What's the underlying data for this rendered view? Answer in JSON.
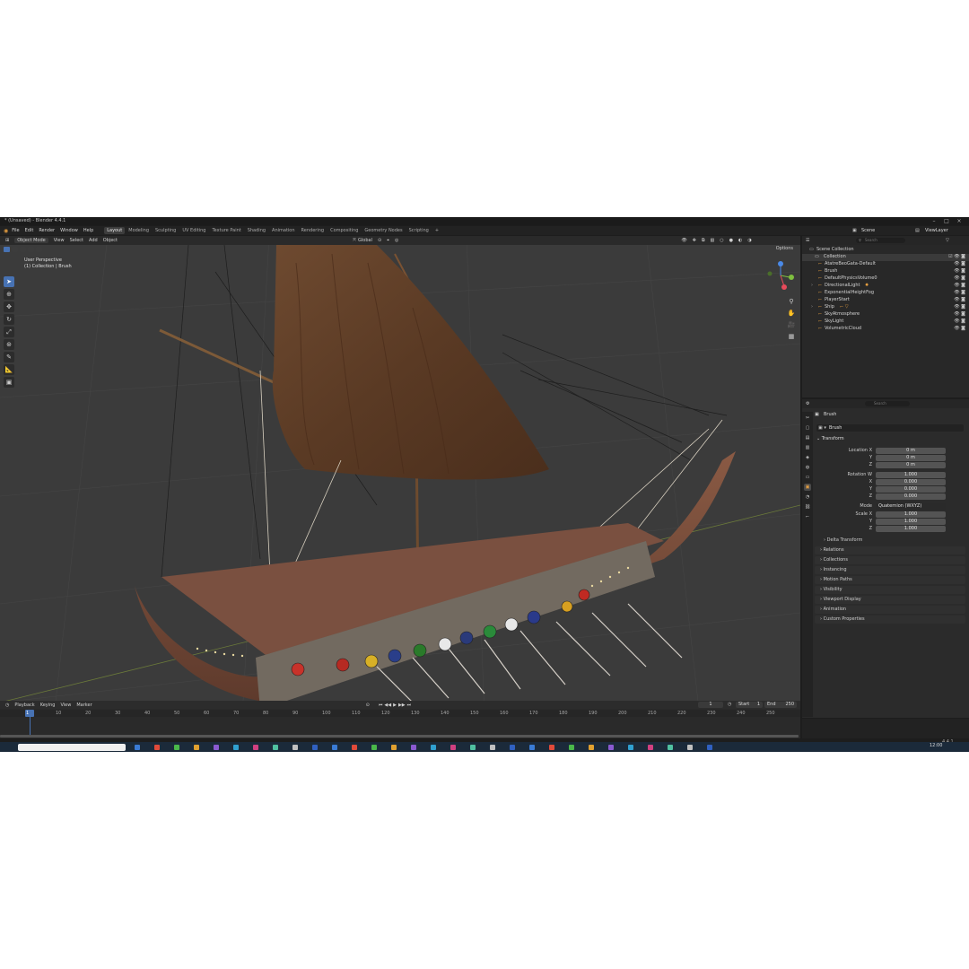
{
  "window": {
    "title": "* (Unsaved) - Blender 4.4.1"
  },
  "menu": [
    "File",
    "Edit",
    "Render",
    "Window",
    "Help"
  ],
  "workspaces": [
    "Layout",
    "Modeling",
    "Sculpting",
    "UV Editing",
    "Texture Paint",
    "Shading",
    "Animation",
    "Rendering",
    "Compositing",
    "Geometry Nodes",
    "Scripting"
  ],
  "top_right": {
    "scene": "Scene",
    "view_layer": "ViewLayer"
  },
  "viewport": {
    "mode": "Object Mode",
    "menu": [
      "View",
      "Select",
      "Add",
      "Object"
    ],
    "orientation": "Global",
    "options_label": "Options",
    "overlay_title": "User Perspective",
    "overlay_sub": "(1) Collection | Brush"
  },
  "outliner": {
    "search_placeholder": "Search",
    "root": "Scene Collection",
    "collection": "Collection",
    "items": [
      "AtatreBeoGata-Default",
      "Brush",
      "DefaultPhysicsVolume0",
      "DirectionalLight",
      "ExponentialHeightFog",
      "PlayerStart",
      "Ship",
      "SkyAtmosphere",
      "SkyLight",
      "VolumetricCloud"
    ]
  },
  "properties": {
    "search_placeholder": "Search",
    "object_name": "Brush",
    "data_name": "Brush",
    "transform_label": "Transform",
    "location": {
      "label": "Location X",
      "y_label": "Y",
      "z_label": "Z",
      "x": "0 m",
      "y": "0 m",
      "z": "0 m"
    },
    "rotation": {
      "label": "Rotation W",
      "x_label": "X",
      "y_label": "Y",
      "z_label": "Z",
      "w": "1.000",
      "x": "0.000",
      "y": "0.000",
      "z": "0.000"
    },
    "mode_label": "Mode",
    "mode_value": "Quaternion (WXYZ)",
    "scale": {
      "label": "Scale X",
      "y_label": "Y",
      "z_label": "Z",
      "x": "1.000",
      "y": "1.000",
      "z": "1.000"
    },
    "delta_transform": "Delta Transform",
    "panels": [
      "Relations",
      "Collections",
      "Instancing",
      "Motion Paths",
      "Visibility",
      "Viewport Display",
      "Animation",
      "Custom Properties"
    ]
  },
  "timeline": {
    "menu": [
      "Playback",
      "Keying",
      "View",
      "Marker"
    ],
    "current_frame": "1",
    "start_label": "Start",
    "start": "1",
    "end_label": "End",
    "end": "250",
    "ticks": [
      "1",
      "10",
      "20",
      "30",
      "40",
      "50",
      "60",
      "70",
      "80",
      "90",
      "100",
      "110",
      "120",
      "130",
      "140",
      "150",
      "160",
      "170",
      "180",
      "190",
      "200",
      "210",
      "220",
      "230",
      "240",
      "250"
    ]
  },
  "status": {
    "version": "4.4.1",
    "clock": "12:00"
  },
  "colors": {
    "accent": "#4772b3",
    "viewport_bg": "#3b3b3b",
    "panel_bg": "#2b2b2b"
  }
}
